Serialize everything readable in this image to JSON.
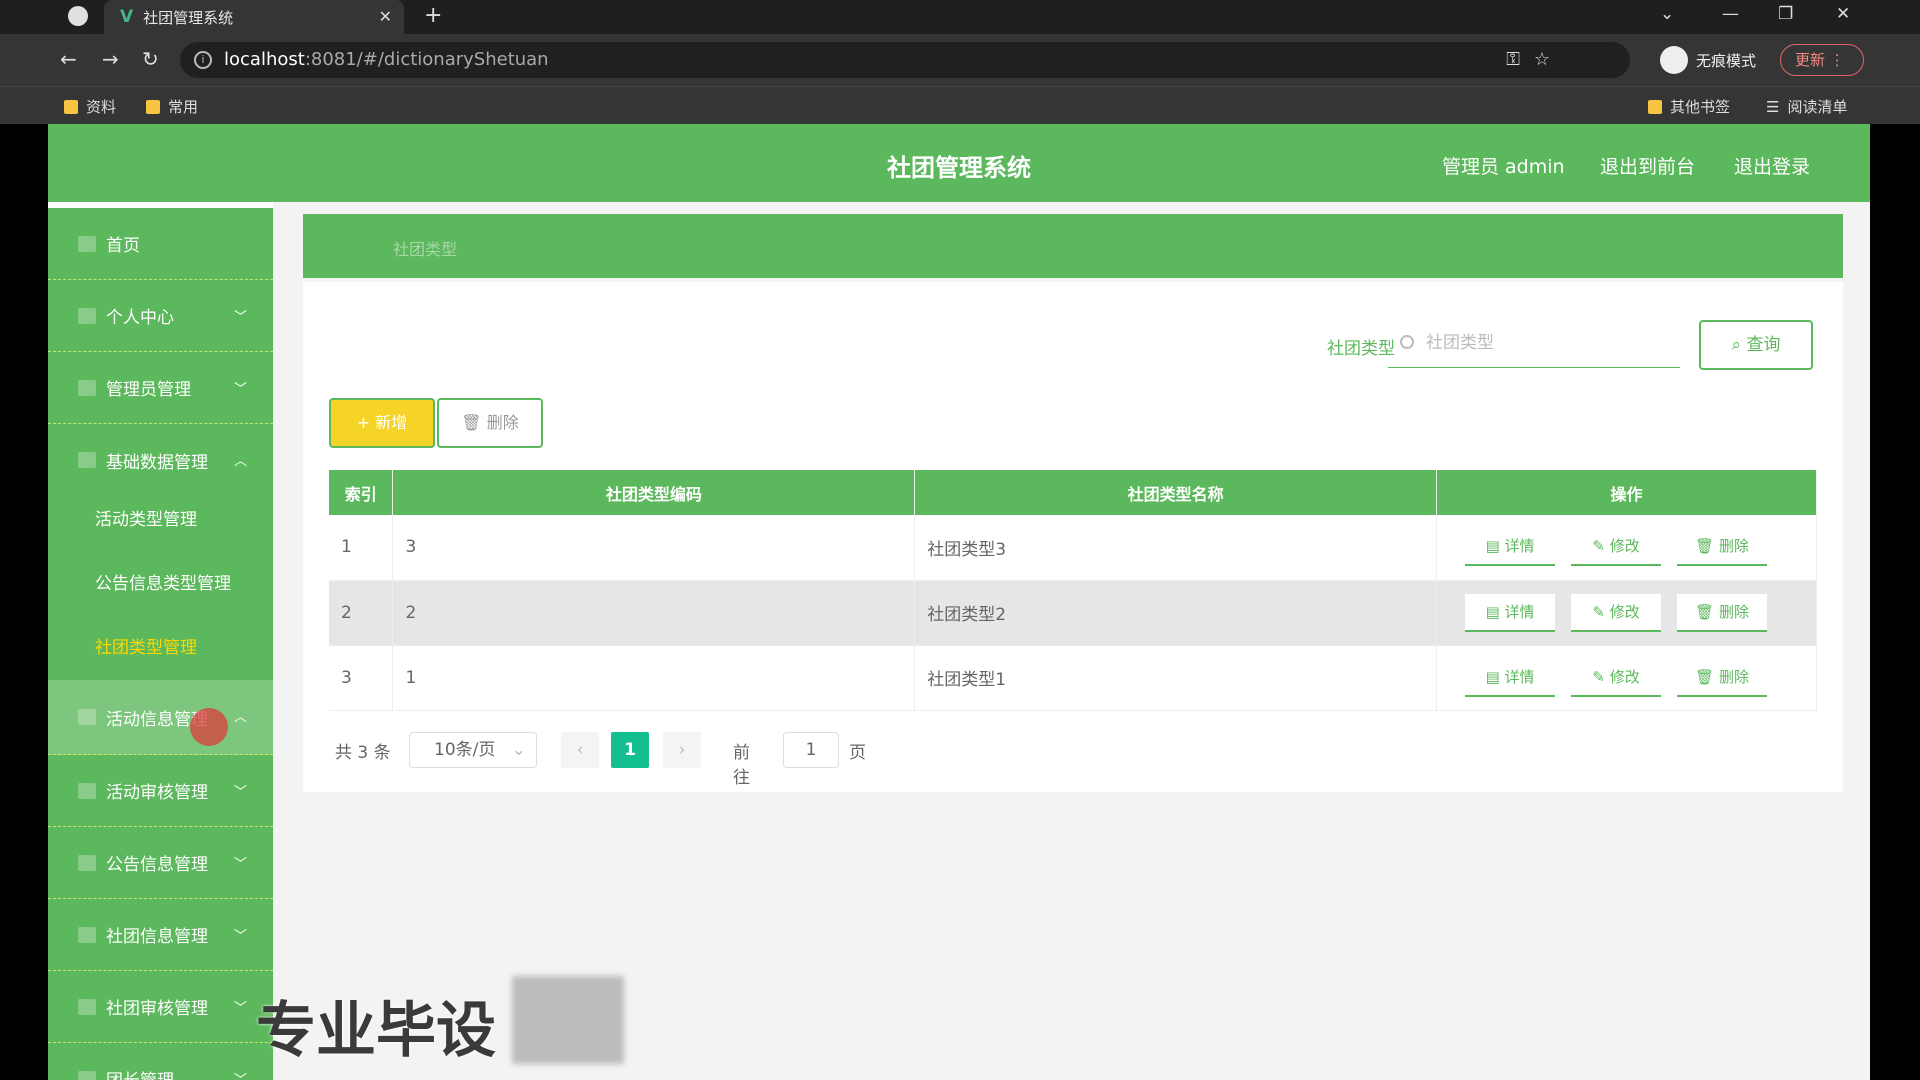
{
  "browser": {
    "tab_title": "社团管理系统",
    "url_host": "localhost",
    "url_path": ":8081/#/dictionaryShetuan",
    "incognito_label": "无痕模式",
    "update_label": "更新",
    "bookmarks": [
      "资料",
      "常用"
    ],
    "bookmarks_right": [
      "其他书签",
      "阅读清单"
    ]
  },
  "header": {
    "title": "社团管理系统",
    "admin": "管理员 admin",
    "to_front": "退出到前台",
    "logout": "退出登录"
  },
  "sidebar": {
    "home": "首页",
    "personal": "个人中心",
    "admin_mgmt": "管理员管理",
    "basic_data": "基础数据管理",
    "sub_activity_type": "活动类型管理",
    "sub_notice_type": "公告信息类型管理",
    "sub_club_type": "社团类型管理",
    "activity_info": "活动信息管理",
    "activity_audit": "活动审核管理",
    "notice_info": "公告信息管理",
    "club_info": "社团信息管理",
    "club_audit": "社团审核管理",
    "leader_mgmt": "团长管理"
  },
  "breadcrumb": "社团类型",
  "search": {
    "label": "社团类型",
    "placeholder": "社团类型",
    "button": "查询"
  },
  "actions": {
    "add": "新增",
    "delete": "删除"
  },
  "table": {
    "headers": [
      "索引",
      "社团类型编码",
      "社团类型名称",
      "操作"
    ],
    "rows": [
      {
        "index": "1",
        "code": "3",
        "name": "社团类型3"
      },
      {
        "index": "2",
        "code": "2",
        "name": "社团类型2"
      },
      {
        "index": "3",
        "code": "1",
        "name": "社团类型1"
      }
    ],
    "op_detail": "详情",
    "op_edit": "修改",
    "op_delete": "删除"
  },
  "pagination": {
    "total": "共 3 条",
    "page_size": "10条/页",
    "current": "1",
    "goto_prefix": "前往",
    "goto_value": "1",
    "goto_suffix": "页"
  },
  "watermark": "专业毕设"
}
